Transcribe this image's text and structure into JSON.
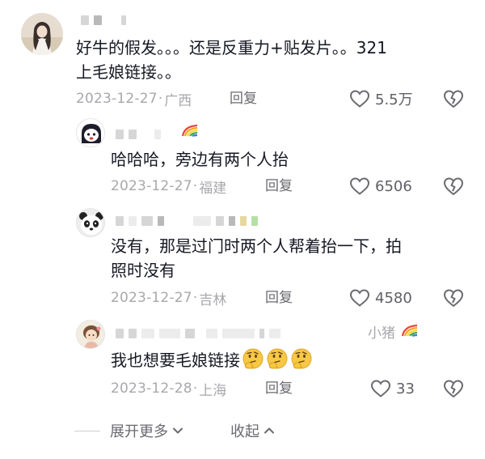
{
  "comments": [
    {
      "text_line1": "好牛的假发。。。还是反重力+贴发片。。321",
      "text_line2": "上毛娘链接。。",
      "date": "2023-12-27",
      "location": "广西",
      "reply_label": "回复",
      "likes": "5.5万"
    },
    {
      "text_line1": "哈哈哈，旁边有两个人抬",
      "date": "2023-12-27",
      "location": "福建",
      "reply_label": "回复",
      "likes": "6506"
    },
    {
      "text_line1": "没有，那是过门时两个人帮着抬一下，拍",
      "text_line2": "照时没有",
      "date": "2023-12-27",
      "location": "吉林",
      "reply_label": "回复",
      "likes": "4580"
    },
    {
      "name_suffix": "小猪",
      "text_line1": "我也想要毛娘链接",
      "date": "2023-12-28",
      "location": "上海",
      "reply_label": "回复",
      "likes": "33"
    }
  ],
  "footer": {
    "expand_label": "展开更多",
    "collapse_label": "收起"
  },
  "colors": {
    "text": "#161823",
    "meta": "#a8a8ad",
    "action": "#6a6a70"
  },
  "icons": [
    "heart-icon",
    "broken-heart-icon",
    "rainbow-icon",
    "thinking-face-emoji",
    "chevron-down-icon",
    "chevron-up-icon"
  ]
}
